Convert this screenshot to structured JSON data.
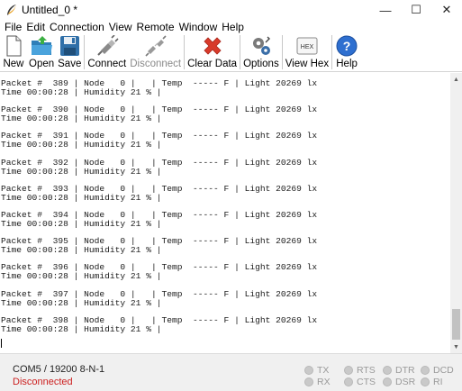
{
  "window": {
    "title": "Untitled_0 *",
    "minimize": "—",
    "maximize": "☐",
    "close": "✕"
  },
  "menu": [
    "File",
    "Edit",
    "Connection",
    "View",
    "Remote",
    "Window",
    "Help"
  ],
  "toolbar": {
    "new": "New",
    "open": "Open",
    "save": "Save",
    "connect": "Connect",
    "disconnect": "Disconnect",
    "clear_data": "Clear Data",
    "options": "Options",
    "view_hex": "View Hex",
    "hex_icon_text": "HEX",
    "help": "Help"
  },
  "terminal": {
    "lines": [
      "Packet #  389 | Node   0 |   | Temp  ----- F | Light 20269 lx",
      "Time 00:00:28 | Humidity 21 % |",
      "Packet #  390 | Node   0 |   | Temp  ----- F | Light 20269 lx",
      "Time 00:00:28 | Humidity 21 % |",
      "Packet #  391 | Node   0 |   | Temp  ----- F | Light 20269 lx",
      "Time 00:00:28 | Humidity 21 % |",
      "Packet #  392 | Node   0 |   | Temp  ----- F | Light 20269 lx",
      "Time 00:00:28 | Humidity 21 % |",
      "Packet #  393 | Node   0 |   | Temp  ----- F | Light 20269 lx",
      "Time 00:00:28 | Humidity 21 % |",
      "Packet #  394 | Node   0 |   | Temp  ----- F | Light 20269 lx",
      "Time 00:00:28 | Humidity 21 % |",
      "Packet #  395 | Node   0 |   | Temp  ----- F | Light 20269 lx",
      "Time 00:00:28 | Humidity 21 % |",
      "Packet #  396 | Node   0 |   | Temp  ----- F | Light 20269 lx",
      "Time 00:00:28 | Humidity 21 % |",
      "Packet #  397 | Node   0 |   | Temp  ----- F | Light 20269 lx",
      "Time 00:00:28 | Humidity 21 % |",
      "Packet #  398 | Node   0 |   | Temp  ----- F | Light 20269 lx",
      "Time 00:00:28 | Humidity 21 % |"
    ]
  },
  "status": {
    "port": "COM5 / 19200 8-N-1",
    "connection": "Disconnected",
    "connection_color": "#cc2020",
    "signals": {
      "tx": "TX",
      "rx": "RX",
      "rts": "RTS",
      "cts": "CTS",
      "dtr": "DTR",
      "dsr": "DSR",
      "dcd": "DCD",
      "ri": "RI"
    }
  }
}
